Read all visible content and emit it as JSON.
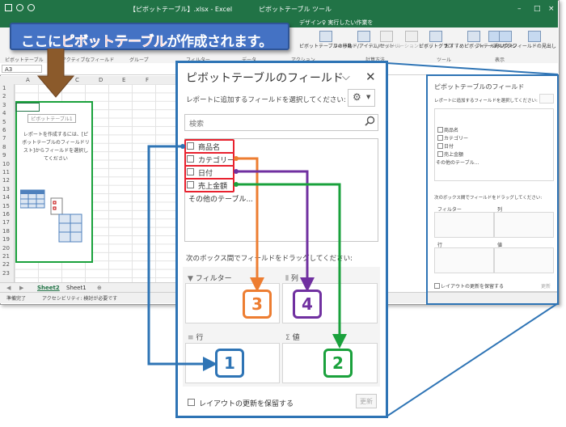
{
  "excel": {
    "title": "【ピボットテーブル】.xlsx - Excel",
    "context_title": "ピボットテーブル ツール",
    "tab_design": "デザイン",
    "tell_me": "♀ 実行したい作業を",
    "name_box": "A3",
    "columns": [
      "A",
      "B",
      "C",
      "D",
      "E",
      "F"
    ],
    "rows": [
      "1",
      "2",
      "3",
      "4",
      "5",
      "6",
      "7",
      "8",
      "9",
      "10",
      "11",
      "12",
      "13",
      "14",
      "15",
      "16",
      "17",
      "18",
      "19",
      "20",
      "21",
      "22",
      "23"
    ],
    "ribbon_groups": [
      "ピボットテーブル",
      "アクティブなフィールド",
      "グループ",
      "フィルター",
      "データ",
      "アクション",
      "計算方法",
      "ツール",
      "表示"
    ],
    "ribbon_buttons": [
      "ピボットテーブルの移動",
      "フィールド/アイテム/セット",
      "OLAP ツール",
      "リレーションシップ",
      "ピボットグラフ",
      "おすすめピボットテーブル",
      "フィールドリスト",
      "+/- ボタン",
      "フィールドの見出し"
    ],
    "placeholder_label": "ピボットテーブル1",
    "placeholder_text": "レポートを作成するには、[ピボットテーブルのフィールドリスト]からフィールドを選択してください",
    "sheet_tabs": [
      "Sheet2",
      "Sheet1"
    ],
    "status_ready": "準備完了",
    "status_access": "アクセシビリティ: 検討が必要です"
  },
  "small_pane": {
    "title": "ピボットテーブルのフィールド",
    "subtitle": "レポートに追加するフィールドを選択してください:",
    "fields": [
      "商品名",
      "カテゴリー",
      "日付",
      "売上金額"
    ],
    "other": "その他のテーブル...",
    "drag_text": "次のボックス間でフィールドをドラッグしてください:",
    "areas": [
      "フィルター",
      "列",
      "行",
      "値"
    ],
    "defer": "レイアウトの更新を保留する",
    "update": "更新"
  },
  "callout": {
    "prefix": "ここに",
    "highlight": "ピボットテーブル",
    "suffix": "が作成されます。"
  },
  "pane": {
    "title": "ピボットテーブルのフィールド",
    "subtitle": "レポートに追加するフィールドを選択してください:",
    "search_placeholder": "検索",
    "fields": [
      "商品名",
      "カテゴリー",
      "日付",
      "売上金額"
    ],
    "other_tables": "その他のテーブル...",
    "drag_instruction": "次のボックス間でフィールドをドラッグしてください:",
    "area_filter": "フィルター",
    "area_columns": "列",
    "area_rows": "行",
    "area_values": "値",
    "defer_label": "レイアウトの更新を保留する",
    "update_button": "更新"
  },
  "annotations": [
    "1",
    "2",
    "3",
    "4"
  ],
  "colors": {
    "excel_green": "#217346",
    "frame_blue": "#2e74b5",
    "field_red": "#e8212e",
    "arrow_blue": "#2e74b5",
    "arrow_green": "#1aa13c",
    "arrow_orange": "#ed7d31",
    "arrow_purple": "#7030a0",
    "callout_bg": "#4472c4",
    "callout_highlight": "#ff3b3b"
  }
}
